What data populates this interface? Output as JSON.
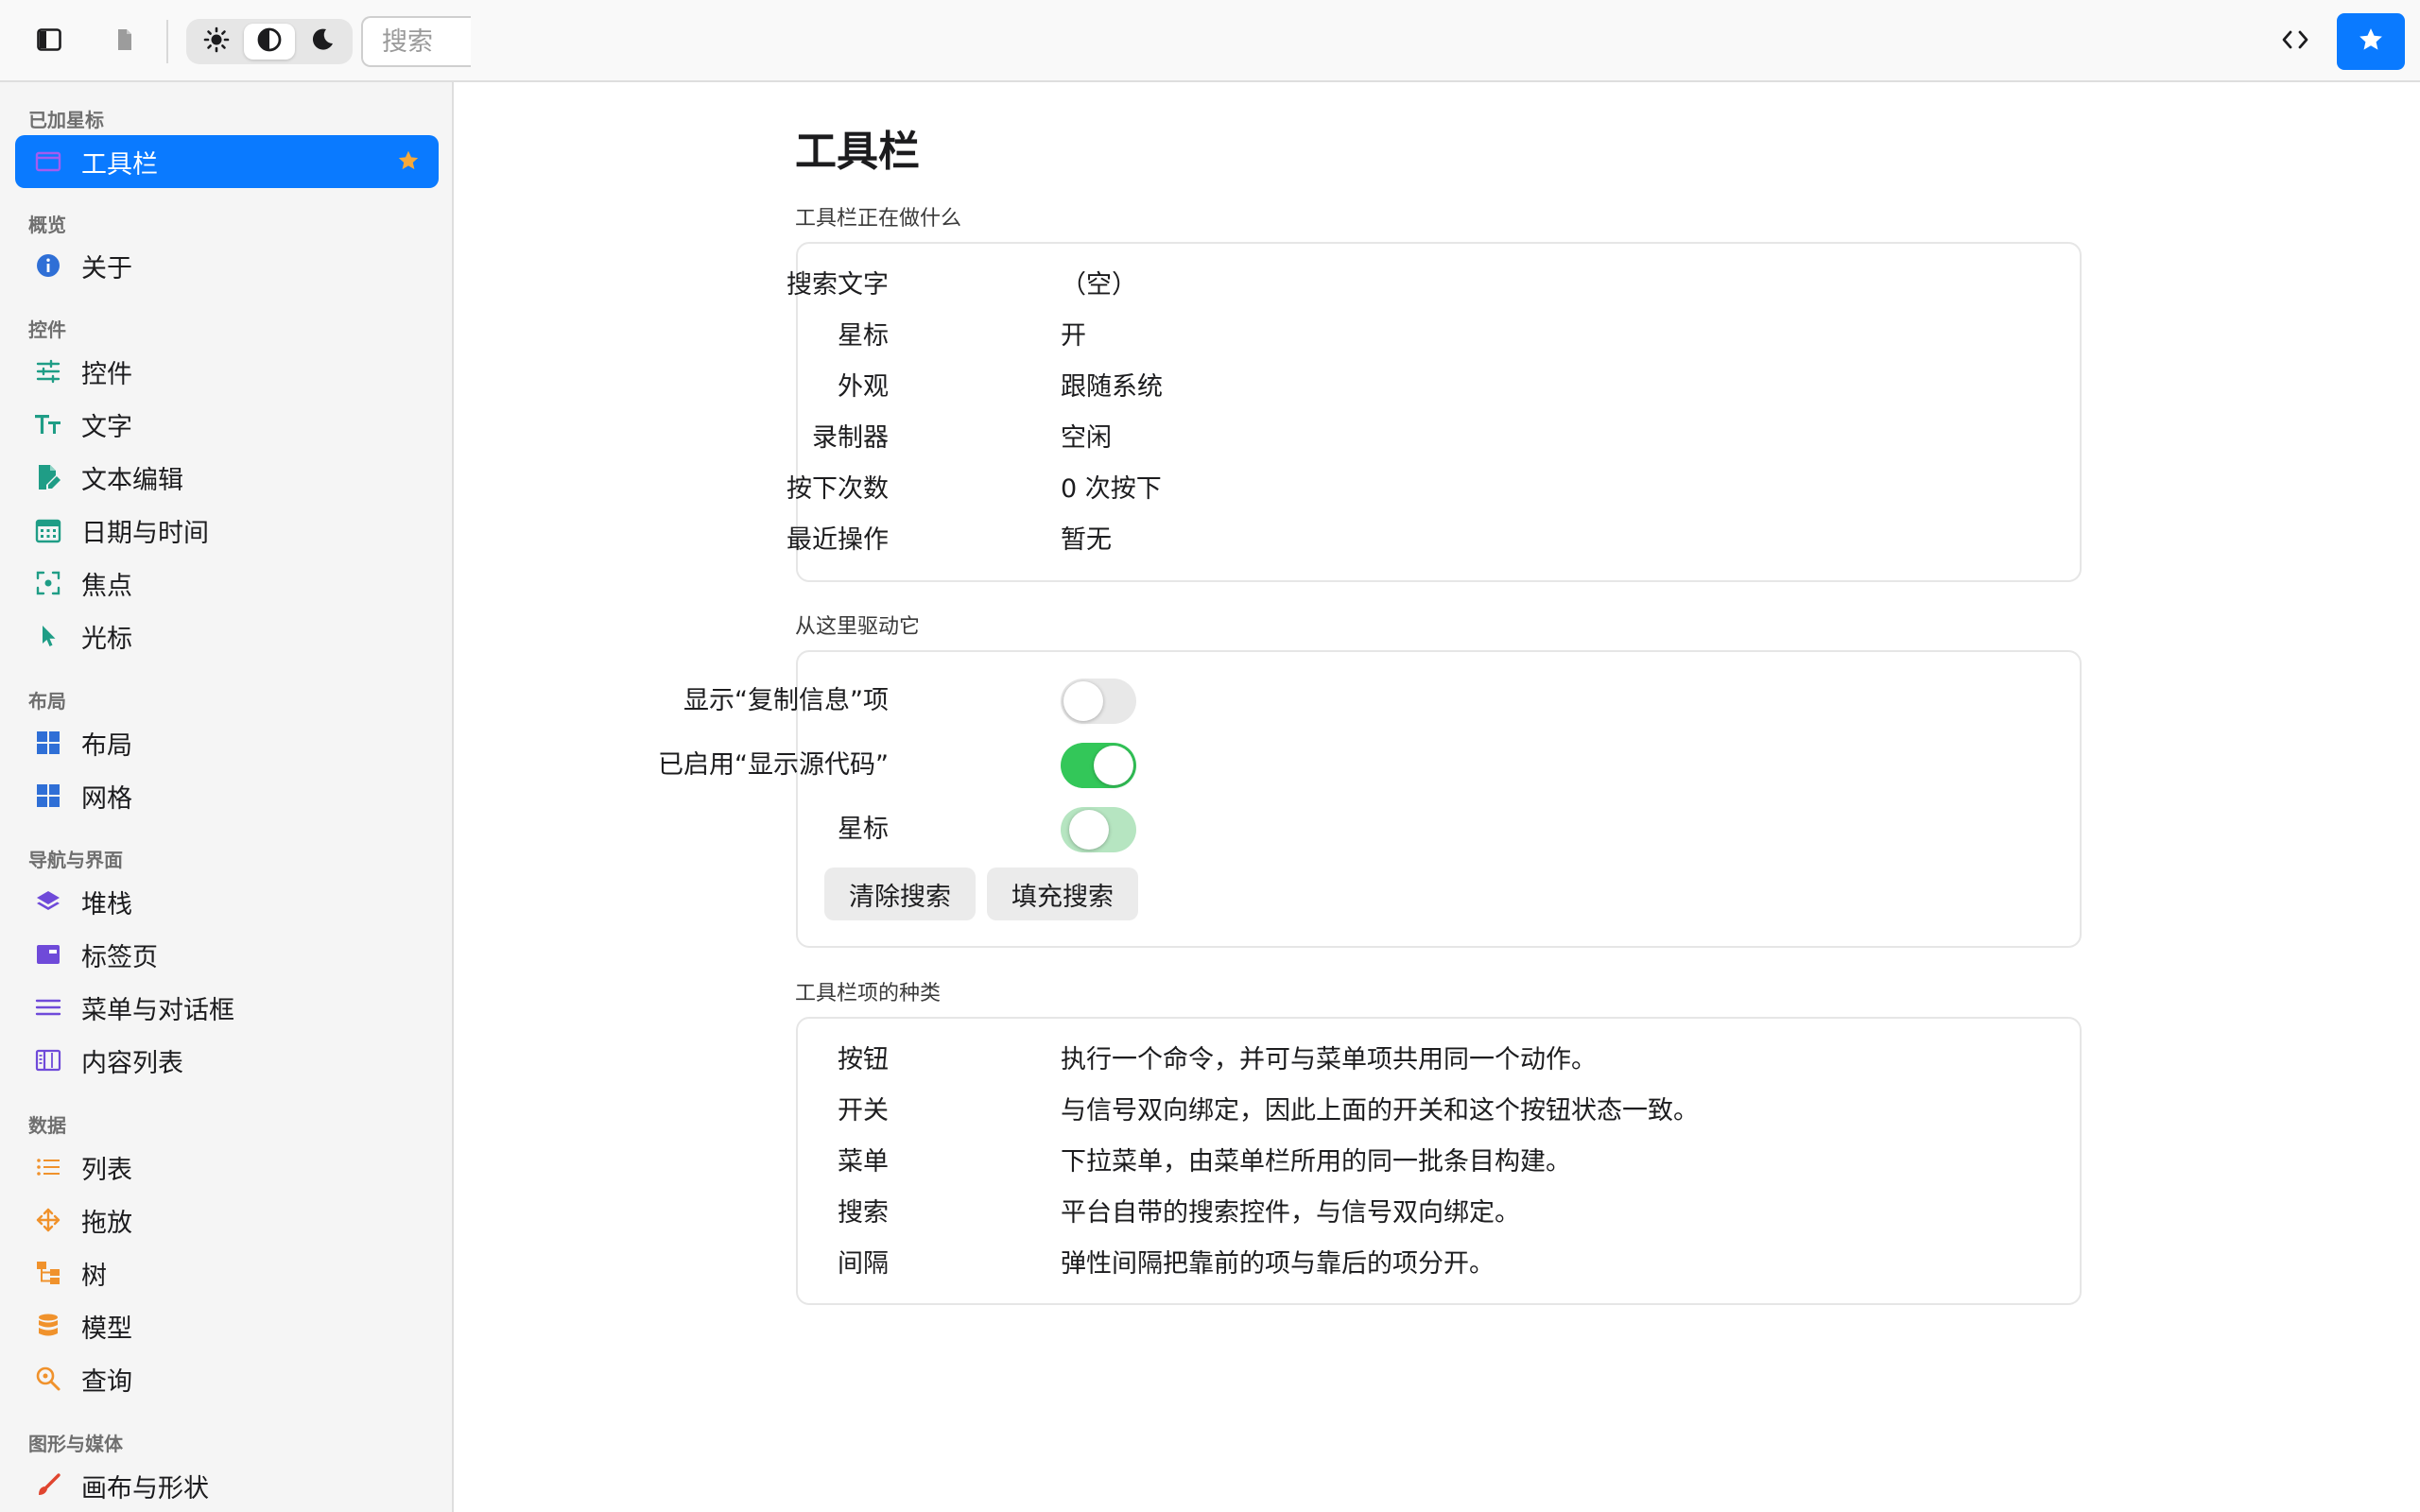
{
  "toolbar": {
    "search_placeholder": "搜索",
    "accent_color": "#0a7aff",
    "appearance_selected": "system"
  },
  "sidebar": {
    "sections": [
      {
        "title": "已加星标",
        "items": [
          {
            "label": "工具栏",
            "icon": "window-icon",
            "selected": true,
            "starred": true
          }
        ]
      },
      {
        "title": "概览",
        "items": [
          {
            "label": "关于",
            "icon": "info-icon"
          }
        ]
      },
      {
        "title": "控件",
        "items": [
          {
            "label": "控件",
            "icon": "sliders-icon"
          },
          {
            "label": "文字",
            "icon": "text-size-icon"
          },
          {
            "label": "文本编辑",
            "icon": "document-edit-icon"
          },
          {
            "label": "日期与时间",
            "icon": "calendar-icon"
          },
          {
            "label": "焦点",
            "icon": "focus-icon"
          },
          {
            "label": "光标",
            "icon": "cursor-icon"
          }
        ]
      },
      {
        "title": "布局",
        "items": [
          {
            "label": "布局",
            "icon": "layout-grid-icon"
          },
          {
            "label": "网格",
            "icon": "grid-icon"
          }
        ]
      },
      {
        "title": "导航与界面",
        "items": [
          {
            "label": "堆栈",
            "icon": "stack-icon"
          },
          {
            "label": "标签页",
            "icon": "tabs-icon"
          },
          {
            "label": "菜单与对话框",
            "icon": "menu-lines-icon"
          },
          {
            "label": "内容列表",
            "icon": "columns-icon"
          }
        ]
      },
      {
        "title": "数据",
        "items": [
          {
            "label": "列表",
            "icon": "list-icon"
          },
          {
            "label": "拖放",
            "icon": "drag-move-icon"
          },
          {
            "label": "树",
            "icon": "tree-icon"
          },
          {
            "label": "模型",
            "icon": "database-icon"
          },
          {
            "label": "查询",
            "icon": "magnifier-icon"
          }
        ]
      },
      {
        "title": "图形与媒体",
        "items": [
          {
            "label": "画布与形状",
            "icon": "brush-icon"
          }
        ]
      }
    ]
  },
  "main": {
    "title": "工具栏",
    "status_section": {
      "header": "工具栏正在做什么",
      "rows": [
        {
          "key": "搜索文字",
          "value": "（空）"
        },
        {
          "key": "星标",
          "value": "开"
        },
        {
          "key": "外观",
          "value": "跟随系统"
        },
        {
          "key": "录制器",
          "value": "空闲"
        },
        {
          "key": "按下次数",
          "value": "0 次按下"
        },
        {
          "key": "最近操作",
          "value": "暂无"
        }
      ]
    },
    "drive_section": {
      "header": "从这里驱动它",
      "toggles": [
        {
          "label": "显示“复制信息”项",
          "state": "off"
        },
        {
          "label": "已启用“显示源代码”",
          "state": "on"
        },
        {
          "label": "星标",
          "state": "toggling"
        }
      ],
      "buttons": {
        "clear": "清除搜索",
        "fill": "填充搜索"
      }
    },
    "kinds_section": {
      "header": "工具栏项的种类",
      "rows": [
        {
          "key": "按钮",
          "value": "执行一个命令，并可与菜单项共用同一个动作。"
        },
        {
          "key": "开关",
          "value": "与信号双向绑定，因此上面的开关和这个按钮状态一致。"
        },
        {
          "key": "菜单",
          "value": "下拉菜单，由菜单栏所用的同一批条目构建。"
        },
        {
          "key": "搜索",
          "value": "平台自带的搜索控件，与信号双向绑定。"
        },
        {
          "key": "间隔",
          "value": "弹性间隔把靠前的项与靠后的项分开。"
        }
      ]
    }
  }
}
